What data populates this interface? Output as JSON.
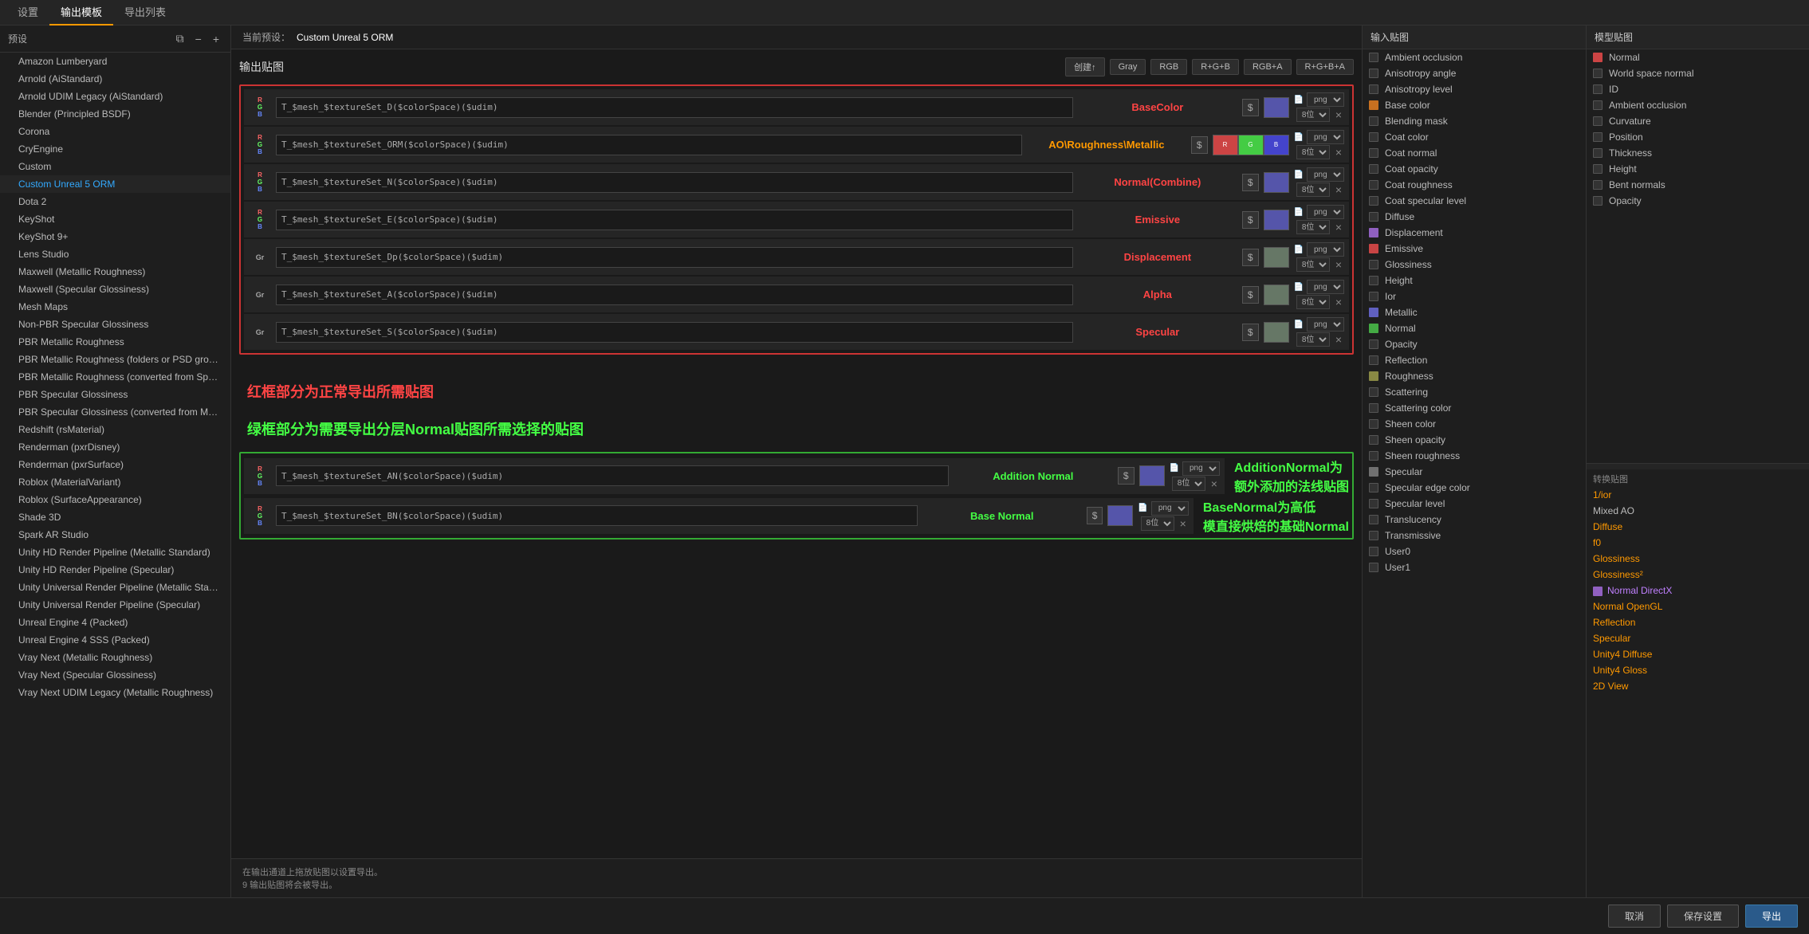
{
  "tabs": [
    "设置",
    "输出模板",
    "导出列表"
  ],
  "activeTab": "输出模板",
  "sidebar": {
    "title": "预设",
    "items": [
      {
        "label": "Amazon Lumberyard",
        "active": false
      },
      {
        "label": "Arnold (AiStandard)",
        "active": false
      },
      {
        "label": "Arnold UDIM Legacy (AiStandard)",
        "active": false
      },
      {
        "label": "Blender (Principled BSDF)",
        "active": false
      },
      {
        "label": "Corona",
        "active": false
      },
      {
        "label": "CryEngine",
        "active": false
      },
      {
        "label": "Custom",
        "active": false
      },
      {
        "label": "Custom Unreal 5 ORM",
        "active": true
      },
      {
        "label": "Dota 2",
        "active": false
      },
      {
        "label": "KeyShot",
        "active": false
      },
      {
        "label": "KeyShot 9+",
        "active": false
      },
      {
        "label": "Lens Studio",
        "active": false
      },
      {
        "label": "Maxwell (Metallic Roughness)",
        "active": false
      },
      {
        "label": "Maxwell (Specular Glossiness)",
        "active": false
      },
      {
        "label": "Mesh Maps",
        "active": false
      },
      {
        "label": "Non-PBR Specular Glossiness",
        "active": false
      },
      {
        "label": "PBR Metallic Roughness",
        "active": false
      },
      {
        "label": "PBR Metallic Roughness (folders or PSD groups)",
        "active": false
      },
      {
        "label": "PBR Metallic Roughness (converted from Specular Glossiness)",
        "active": false
      },
      {
        "label": "PBR Specular Glossiness",
        "active": false
      },
      {
        "label": "PBR Specular Glossiness (converted from Metallic Roughness)",
        "active": false
      },
      {
        "label": "Redshift (rsMaterial)",
        "active": false
      },
      {
        "label": "Renderman (pxrDisney)",
        "active": false
      },
      {
        "label": "Renderman (pxrSurface)",
        "active": false
      },
      {
        "label": "Roblox (MaterialVariant)",
        "active": false
      },
      {
        "label": "Roblox (SurfaceAppearance)",
        "active": false
      },
      {
        "label": "Shade 3D",
        "active": false
      },
      {
        "label": "Spark AR Studio",
        "active": false
      },
      {
        "label": "Unity HD Render Pipeline (Metallic Standard)",
        "active": false
      },
      {
        "label": "Unity HD Render Pipeline (Specular)",
        "active": false
      },
      {
        "label": "Unity Universal Render Pipeline (Metallic Standard)",
        "active": false
      },
      {
        "label": "Unity Universal Render Pipeline (Specular)",
        "active": false
      },
      {
        "label": "Unreal Engine 4 (Packed)",
        "active": false
      },
      {
        "label": "Unreal Engine 4 SSS (Packed)",
        "active": false
      },
      {
        "label": "Vray Next (Metallic Roughness)",
        "active": false
      },
      {
        "label": "Vray Next (Specular Glossiness)",
        "active": false
      },
      {
        "label": "Vray Next UDIM Legacy (Metallic Roughness)",
        "active": false
      }
    ]
  },
  "preset": {
    "label": "当前预设：",
    "name": "Custom Unreal 5 ORM"
  },
  "output": {
    "title": "输出贴图",
    "createBtn": "创建↑",
    "colorBtns": [
      "Gray",
      "RGB",
      "R+G+B",
      "RGB+A",
      "R+G+B+A"
    ],
    "textures": {
      "red": [
        {
          "name": "T_$mesh_$textureSet_D($colorSpace)($udim)",
          "label": "BaseColor",
          "labelColor": "#ff4444",
          "channelType": "RGB",
          "channels": [],
          "format": "png",
          "bits": "8位"
        },
        {
          "name": "T_$mesh_$textureSet_ORM($colorSpace)($udim)",
          "label": "AO\\Roughness\\Metallic",
          "labelColor": "#ff9900",
          "channelType": "RGB",
          "channels": [
            "R",
            "G",
            "B"
          ],
          "format": "png",
          "bits": "8位"
        },
        {
          "name": "T_$mesh_$textureSet_N($colorSpace)($udim)",
          "label": "Normal(Combine)",
          "labelColor": "#ff4444",
          "channelType": "RGB",
          "channels": [],
          "format": "png",
          "bits": "8位"
        },
        {
          "name": "T_$mesh_$textureSet_E($colorSpace)($udim)",
          "label": "Emissive",
          "labelColor": "#ff4444",
          "channelType": "RGB",
          "channels": [],
          "format": "png",
          "bits": "8位"
        },
        {
          "name": "T_$mesh_$textureSet_Dp($colorSpace)($udim)",
          "label": "Displacement",
          "labelColor": "#ff4444",
          "channelType": "Gr",
          "channels": [],
          "format": "png",
          "bits": "8位"
        },
        {
          "name": "T_$mesh_$textureSet_A($colorSpace)($udim)",
          "label": "Alpha",
          "labelColor": "#ff4444",
          "channelType": "Gr",
          "channels": [],
          "format": "png",
          "bits": "8位"
        },
        {
          "name": "T_$mesh_$textureSet_S($colorSpace)($udim)",
          "label": "Specular",
          "labelColor": "#ff4444",
          "channelType": "Gr",
          "channels": [],
          "format": "png",
          "bits": "8位"
        }
      ],
      "green": [
        {
          "name": "T_$mesh_$textureSet_AN($colorSpace)($udim)",
          "label": "Addition Normal",
          "labelColor": "#44ff44",
          "channelType": "RGB",
          "channels": [],
          "format": "png",
          "bits": "8位",
          "annotation": "AdditionNormal为\n额外添加的法线贴图"
        },
        {
          "name": "T_$mesh_$textureSet_BN($colorSpace)($udim)",
          "label": "Base Normal",
          "labelColor": "#44ff44",
          "channelType": "RGB",
          "channels": [],
          "format": "png",
          "bits": "8位",
          "annotation": "BaseNormal为高低\n模直接烘焙的基础Normal"
        }
      ]
    },
    "annotations": {
      "red": "红框部分为正常导出所需贴图",
      "green": "绿框部分为需要导出分层Normal贴图所需选择的贴图"
    },
    "status1": "在输出通道上拖放贴图以设置导出。",
    "status2": "9 输出贴图将会被导出。"
  },
  "inputMaps": {
    "title": "输入贴图",
    "items": [
      {
        "label": "Ambient occlusion",
        "color": null
      },
      {
        "label": "Anisotropy angle",
        "color": null
      },
      {
        "label": "Anisotropy level",
        "color": null
      },
      {
        "label": "Base color",
        "color": "#c87020"
      },
      {
        "label": "Blending mask",
        "color": null
      },
      {
        "label": "Coat color",
        "color": null
      },
      {
        "label": "Coat normal",
        "color": null
      },
      {
        "label": "Coat opacity",
        "color": null
      },
      {
        "label": "Coat roughness",
        "color": null
      },
      {
        "label": "Coat specular level",
        "color": null
      },
      {
        "label": "Diffuse",
        "color": null
      },
      {
        "label": "Displacement",
        "color": "#9060c0"
      },
      {
        "label": "Emissive",
        "color": "#c84444"
      },
      {
        "label": "Glossiness",
        "color": null
      },
      {
        "label": "Height",
        "color": null
      },
      {
        "label": "Ior",
        "color": null
      },
      {
        "label": "Metallic",
        "color": "#6060c0"
      },
      {
        "label": "Normal",
        "color": "#44aa44"
      },
      {
        "label": "Opacity",
        "color": null
      },
      {
        "label": "Reflection",
        "color": null
      },
      {
        "label": "Roughness",
        "color": "#888844"
      },
      {
        "label": "Scattering",
        "color": null
      },
      {
        "label": "Scattering color",
        "color": null
      },
      {
        "label": "Sheen color",
        "color": null
      },
      {
        "label": "Sheen opacity",
        "color": null
      },
      {
        "label": "Sheen roughness",
        "color": null
      },
      {
        "label": "Specular",
        "color": "#707070"
      },
      {
        "label": "Specular edge color",
        "color": null
      },
      {
        "label": "Specular level",
        "color": null
      },
      {
        "label": "Translucency",
        "color": null
      },
      {
        "label": "Transmissive",
        "color": null
      },
      {
        "label": "User0",
        "color": null
      },
      {
        "label": "User1",
        "color": null
      }
    ]
  },
  "modelMaps": {
    "title": "模型贴图",
    "items": [
      {
        "label": "Normal",
        "color": "#cc4444"
      },
      {
        "label": "World space normal",
        "color": null
      },
      {
        "label": "ID",
        "color": null
      },
      {
        "label": "Ambient occlusion",
        "color": null
      },
      {
        "label": "Curvature",
        "color": null
      },
      {
        "label": "Position",
        "color": null
      },
      {
        "label": "Thickness",
        "color": null
      },
      {
        "label": "Height",
        "color": null
      },
      {
        "label": "Bent normals",
        "color": null
      },
      {
        "label": "Opacity",
        "color": null
      }
    ]
  },
  "conversionMaps": {
    "title": "转换贴图",
    "items": [
      {
        "label": "1/ior",
        "color": null,
        "style": "orange"
      },
      {
        "label": "Mixed AO",
        "color": null,
        "style": "normal"
      },
      {
        "label": "Diffuse",
        "color": null,
        "style": "orange"
      },
      {
        "label": "f0",
        "color": null,
        "style": "orange"
      },
      {
        "label": "Glossiness",
        "color": null,
        "style": "orange"
      },
      {
        "label": "Glossiness²",
        "color": null,
        "style": "orange"
      },
      {
        "label": "Normal DirectX",
        "color": "#9060c0",
        "style": "purple"
      },
      {
        "label": "Normal OpenGL",
        "color": null,
        "style": "orange"
      },
      {
        "label": "Reflection",
        "color": null,
        "style": "orange"
      },
      {
        "label": "Specular",
        "color": null,
        "style": "orange"
      },
      {
        "label": "Unity4 Diffuse",
        "color": null,
        "style": "orange"
      },
      {
        "label": "Unity4 Gloss",
        "color": null,
        "style": "orange"
      },
      {
        "label": "2D View",
        "color": null,
        "style": "orange"
      }
    ]
  },
  "bottomBar": {
    "cancelBtn": "取消",
    "saveBtn": "保存设置",
    "exportBtn": "导出"
  }
}
